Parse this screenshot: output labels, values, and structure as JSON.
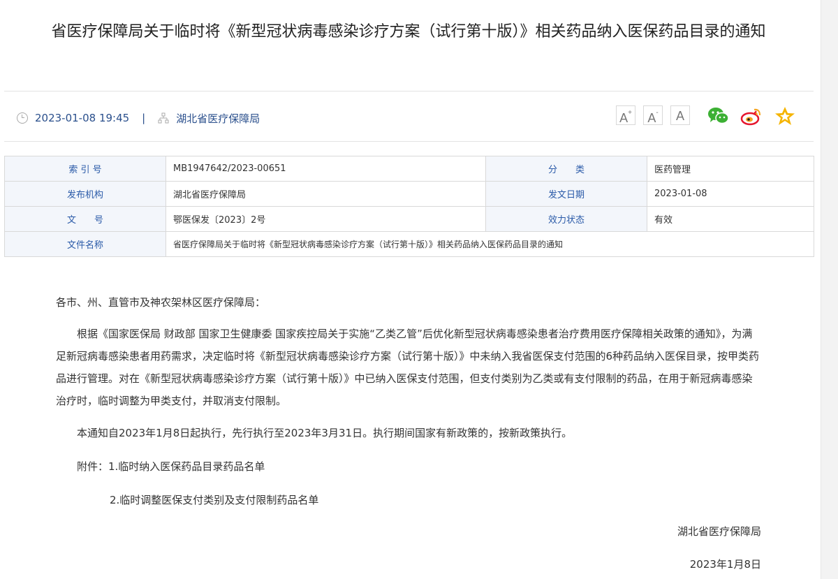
{
  "article": {
    "title": "省医疗保障局关于临时将《新型冠状病毒感染诊疗方案（试行第十版）》相关药品纳入医保药品目录的通知"
  },
  "meta": {
    "datetime": "2023-01-08 19:45",
    "separator": "|",
    "org": "湖北省医疗保障局"
  },
  "toolbar": {
    "font_larger": "A",
    "font_smaller": "A",
    "font_default": "A"
  },
  "info_table": {
    "index_label": "索 引 号",
    "index_value": "MB1947642/2023-00651",
    "category_label": "分　　类",
    "category_value": "医药管理",
    "publisher_label": "发布机构",
    "publisher_value": "湖北省医疗保障局",
    "date_label": "发文日期",
    "date_value": "2023-01-08",
    "docno_label": "文　　号",
    "docno_value": "鄂医保发〔2023〕2号",
    "status_label": "效力状态",
    "status_value": "有效",
    "filename_label": "文件名称",
    "filename_value": "省医疗保障局关于临时将《新型冠状病毒感染诊疗方案（试行第十版）》相关药品纳入医保药品目录的通知"
  },
  "content": {
    "salutation": "各市、州、直管市及神农架林区医疗保障局：",
    "para1": "根据《国家医保局 财政部 国家卫生健康委 国家疾控局关于实施“乙类乙管”后优化新型冠状病毒感染患者治疗费用医疗保障相关政策的通知》，为满足新冠病毒感染患者用药需求，决定临时将《新型冠状病毒感染诊疗方案（试行第十版）》中未纳入我省医保支付范围的6种药品纳入医保目录，按甲类药品进行管理。对在《新型冠状病毒感染诊疗方案（试行第十版）》中已纳入医保支付范围，但支付类别为乙类或有支付限制的药品，在用于新冠病毒感染治疗时，临时调整为甲类支付，并取消支付限制。",
    "para2": "本通知自2023年1月8日起执行，先行执行至2023年3月31日。执行期间国家有新政策的，按新政策执行。",
    "attachment1": "附件：1.临时纳入医保药品目录药品名单",
    "attachment2": "2.临时调整医保支付类别及支付限制药品名单",
    "signature": "湖北省医疗保障局",
    "sign_date": "2023年1月8日"
  },
  "icons": {
    "clock": "clock-icon",
    "org": "org-chart-icon",
    "wechat": "wechat-icon",
    "weibo": "weibo-icon",
    "favorite": "star-icon"
  },
  "colors": {
    "accent": "#2a5aa8",
    "table_label_bg": "#f3f6fb",
    "wechat": "#3cb034",
    "weibo": "#e6162d",
    "star": "#f5b400"
  }
}
